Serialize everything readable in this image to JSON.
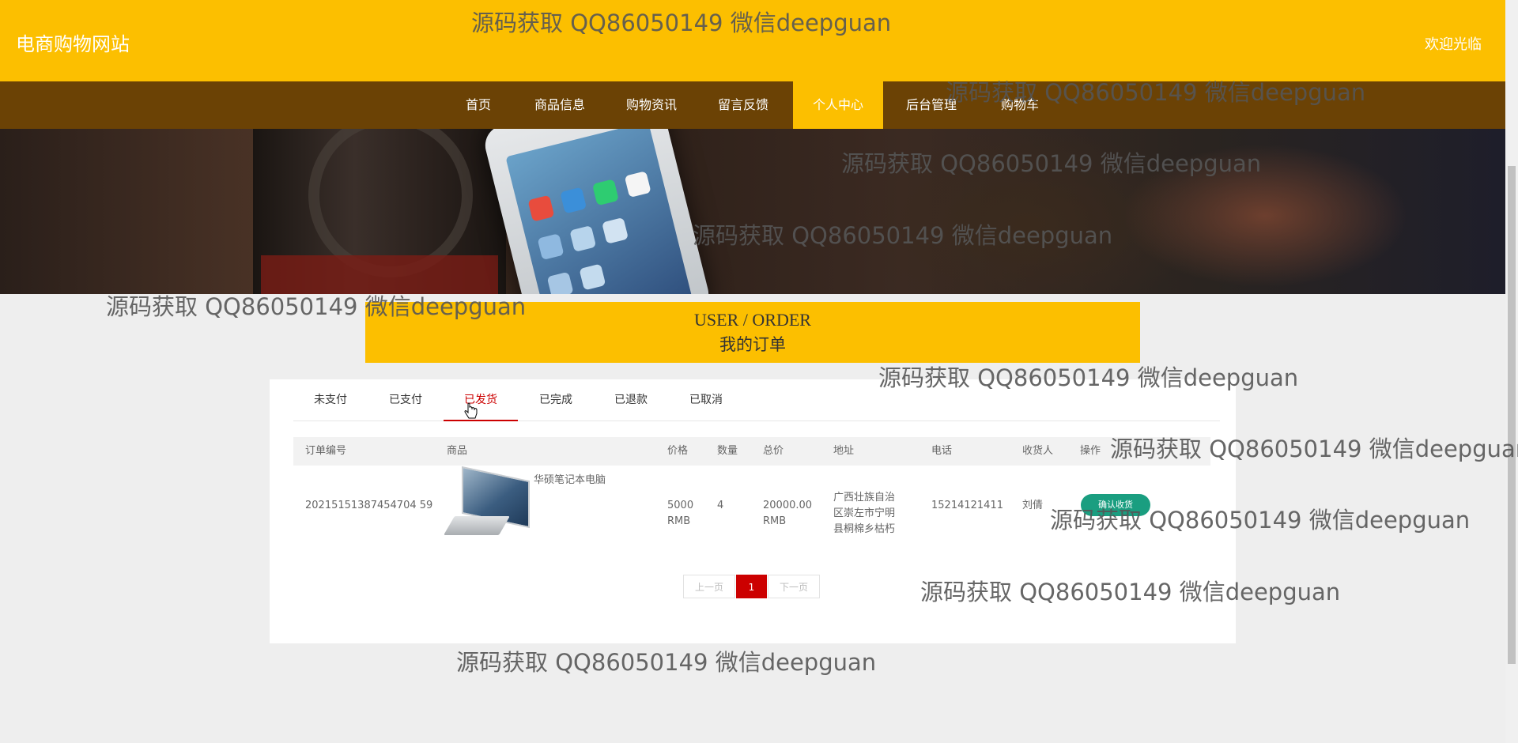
{
  "header": {
    "site_title": "电商购物网站",
    "welcome": "欢迎光临"
  },
  "nav": {
    "items": [
      {
        "label": "首页"
      },
      {
        "label": "商品信息"
      },
      {
        "label": "购物资讯"
      },
      {
        "label": "留言反馈"
      },
      {
        "label": "个人中心",
        "active": true
      },
      {
        "label": "后台管理"
      },
      {
        "label": "购物车"
      }
    ]
  },
  "banner": {
    "slides": 3,
    "active_slide": 1
  },
  "section": {
    "title_en": "USER / ORDER",
    "title_cn": "我的订单"
  },
  "tabs": [
    {
      "label": "未支付"
    },
    {
      "label": "已支付"
    },
    {
      "label": "已发货",
      "active": true
    },
    {
      "label": "已完成"
    },
    {
      "label": "已退款"
    },
    {
      "label": "已取消"
    }
  ],
  "table": {
    "headers": [
      "订单编号",
      "商品",
      "价格",
      "数量",
      "总价",
      "地址",
      "电话",
      "收货人",
      "操作"
    ],
    "rows": [
      {
        "order_no": "20215151387454704 59",
        "product": "华硕笔记本电脑",
        "price": "5000 RMB",
        "qty": "4",
        "total": "20000.00 RMB",
        "address": "广西壮族自治区崇左市宁明县桐棉乡枯朽",
        "phone": "15214121411",
        "receiver": "刘倩",
        "action": "确认收货"
      }
    ]
  },
  "pager": {
    "prev": "上一页",
    "current": "1",
    "next": "下一页"
  },
  "watermark": "源码获取 QQ86050149 微信deepguan",
  "colors": {
    "header_bg": "#fcbf00",
    "nav_bg": "#6b4205",
    "tab_active": "#cc0000",
    "action_button": "#1a9e80"
  }
}
